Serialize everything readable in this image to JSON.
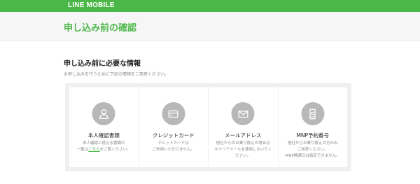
{
  "header": {
    "brand": "LINE MOBILE"
  },
  "page": {
    "title": "申し込み前の確認"
  },
  "section": {
    "title": "申し込み前に必要な情報",
    "subtitle": "お申し込みを行うために下記の情報をご用意ください。"
  },
  "cards": [
    {
      "icon": "person-icon",
      "title": "本人確認書類",
      "desc_line1": "本人確認に使える書類の",
      "desc_prefix": "一覧は",
      "desc_link": "こちら",
      "desc_suffix": "をご覧ください。"
    },
    {
      "icon": "credit-card-icon",
      "title": "クレジットカード",
      "desc_line1": "デビットカードは",
      "desc_line2": "ご利用いただけません。"
    },
    {
      "icon": "mail-icon",
      "title": "メールアドレス",
      "desc_line1": "他社からのお乗り換えの場合は",
      "desc_line2": "キャリアメールを使用しないでく",
      "desc_line3": "ださい。"
    },
    {
      "icon": "phone-icon",
      "title": "MNP予約番号",
      "desc_line1": "他社からお乗り換えの方のみ",
      "desc_line2": "ご用意ください。",
      "desc_line3": "MNP開通日は指定できません。"
    }
  ],
  "colors": {
    "accent": "#4cb749",
    "icon_bg": "#b8b8b8",
    "box_bg": "#f0f0f0"
  }
}
